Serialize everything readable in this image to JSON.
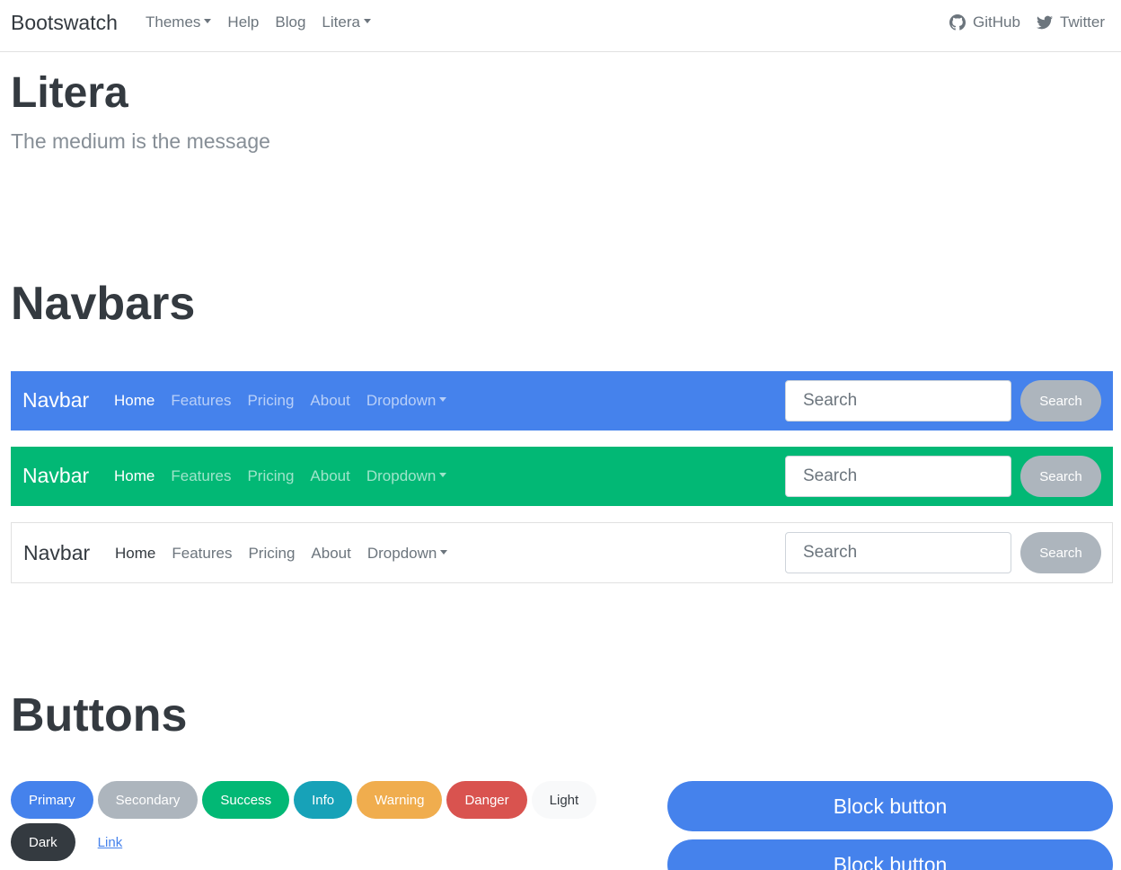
{
  "topbar": {
    "brand": "Bootswatch",
    "links": [
      "Themes",
      "Help",
      "Blog",
      "Litera"
    ],
    "right": [
      "GitHub",
      "Twitter"
    ]
  },
  "header": {
    "title": "Litera",
    "lead": "The medium is the message"
  },
  "sections": {
    "navbars": "Navbars",
    "buttons": "Buttons"
  },
  "navbar_example": {
    "brand": "Navbar",
    "links": [
      "Home",
      "Features",
      "Pricing",
      "About",
      "Dropdown"
    ],
    "search_placeholder": "Search",
    "search_button": "Search"
  },
  "buttons": {
    "row1": [
      "Primary",
      "Secondary",
      "Success",
      "Info",
      "Warning",
      "Danger",
      "Light"
    ],
    "row2": [
      "Dark",
      "Link"
    ],
    "block": [
      "Block button",
      "Block button"
    ]
  },
  "colors": {
    "primary": "#4582ec",
    "secondary": "#adb5bd",
    "success": "#02b875",
    "info": "#17a2b8",
    "warning": "#f0ad4e",
    "danger": "#d9534f",
    "light": "#f8f9fa",
    "dark": "#343a40"
  },
  "icons": [
    "github-icon",
    "twitter-icon",
    "caret-down-icon"
  ]
}
